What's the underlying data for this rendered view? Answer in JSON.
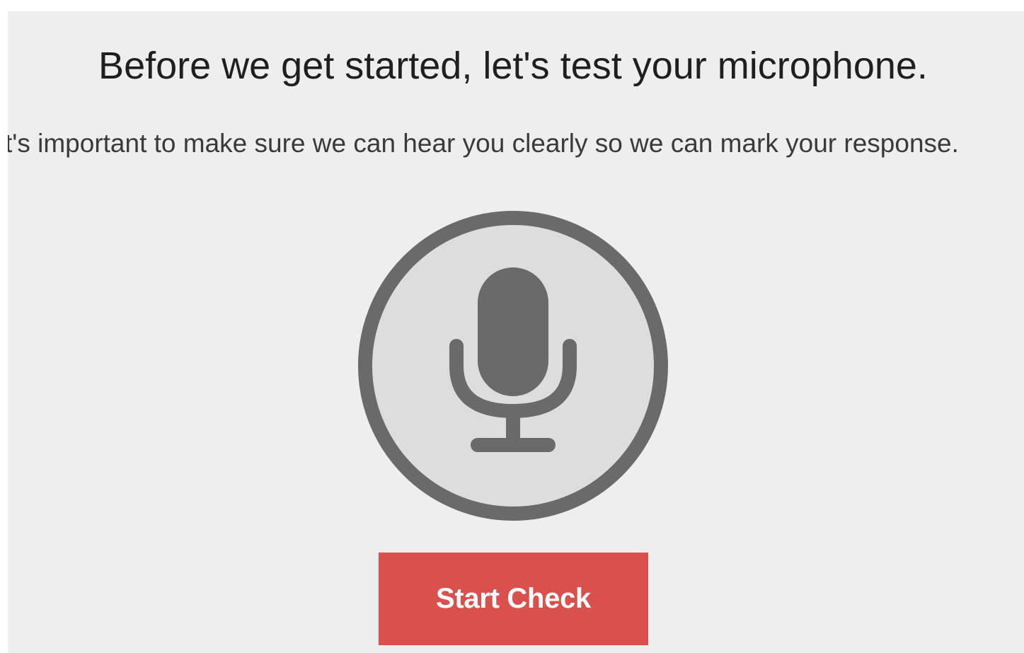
{
  "prompt": {
    "title": "Before we get started, let's test your microphone.",
    "subtitle": "t's important to make sure we can hear you clearly so we can mark your response."
  },
  "microphone": {
    "icon": "microphone-icon",
    "ring_color": "#6a6a6a",
    "fill_color": "#dddddd"
  },
  "actions": {
    "start_label": "Start Check",
    "accent_color": "#d9504d"
  }
}
